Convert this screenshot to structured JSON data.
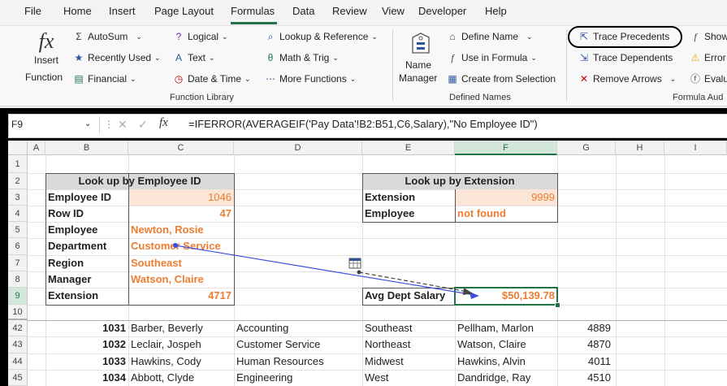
{
  "tabs": [
    "File",
    "Home",
    "Insert",
    "Page Layout",
    "Formulas",
    "Data",
    "Review",
    "View",
    "Developer",
    "Help"
  ],
  "active_tab": "Formulas",
  "ribbon": {
    "insert_function": {
      "icon_text": "fx",
      "label1": "Insert",
      "label2": "Function"
    },
    "autosum": "AutoSum",
    "recently_used": "Recently Used",
    "financial": "Financial",
    "logical": "Logical",
    "text": "Text",
    "date_time": "Date & Time",
    "lookup_reference": "Lookup & Reference",
    "math_trig": "Math & Trig",
    "more_functions": "More Functions",
    "function_library_label": "Function Library",
    "name_manager1": "Name",
    "name_manager2": "Manager",
    "define_name": "Define Name",
    "use_in_formula": "Use in Formula",
    "create_from_selection": "Create from Selection",
    "defined_names_label": "Defined Names",
    "trace_precedents": "Trace Precedents",
    "trace_dependents": "Trace Dependents",
    "remove_arrows": "Remove Arrows",
    "show": "Show",
    "error": "Error",
    "evaluate": "Evalu",
    "formula_auditing_label": "Formula Aud"
  },
  "formula_bar": {
    "name_box": "F9",
    "fx": "fx",
    "formula": "=IFERROR(AVERAGEIF('Pay Data'!B2:B51,C6,Salary),\"No Employee ID\")"
  },
  "columns": [
    "A",
    "B",
    "C",
    "D",
    "E",
    "F",
    "G",
    "H",
    "I"
  ],
  "selected_column": "F",
  "rows": [
    "1",
    "2",
    "3",
    "4",
    "5",
    "6",
    "7",
    "8",
    "9",
    "10",
    "42",
    "43",
    "44",
    "45"
  ],
  "selected_row": "9",
  "lookup_id": {
    "title": "Look up by Employee ID",
    "rows": [
      {
        "label": "Employee ID",
        "value": "1046"
      },
      {
        "label": "Row ID",
        "value": "47"
      },
      {
        "label": "Employee",
        "value": "Newton, Rosie"
      },
      {
        "label": "Department",
        "value": "Customer Service"
      },
      {
        "label": "Region",
        "value": "Southeast"
      },
      {
        "label": "Manager",
        "value": "Watson, Claire"
      },
      {
        "label": "Extension",
        "value": "4717"
      }
    ]
  },
  "lookup_ext": {
    "title": "Look up by Extension",
    "rows": [
      {
        "label": "Extension",
        "value": "9999"
      },
      {
        "label": "Employee",
        "value": "not found"
      }
    ]
  },
  "avg_salary": {
    "label": "Avg Dept Salary",
    "value": "$50,139.78"
  },
  "data_rows": [
    {
      "id": "1031",
      "name": "Barber, Beverly",
      "dept": "Accounting",
      "region": "Southeast",
      "manager": "Pellham, Marlon",
      "ext": "4889"
    },
    {
      "id": "1032",
      "name": "Leclair, Jospeh",
      "dept": "Customer Service",
      "region": "Northeast",
      "manager": "Watson, Claire",
      "ext": "4870"
    },
    {
      "id": "1033",
      "name": "Hawkins, Cody",
      "dept": "Human Resources",
      "region": "Midwest",
      "manager": "Hawkins, Alvin",
      "ext": "4011"
    },
    {
      "id": "1034",
      "name": "Abbott, Clyde",
      "dept": "Engineering",
      "region": "West",
      "manager": "Dandridge, Ray",
      "ext": "4510"
    }
  ],
  "colors": {
    "accent": "#217346",
    "orange": "#ed7d31",
    "arrow_blue": "#3a4fe0",
    "highlight_circle": "#000000"
  }
}
